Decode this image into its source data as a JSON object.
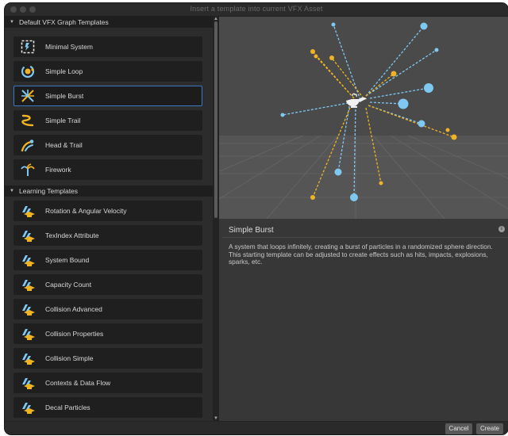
{
  "window": {
    "title": "Insert a template into current VFX Asset"
  },
  "sections": [
    {
      "label": "Default VFX Graph Templates",
      "items": [
        {
          "label": "Minimal System",
          "icon": "minimal-system-icon"
        },
        {
          "label": "Simple Loop",
          "icon": "simple-loop-icon"
        },
        {
          "label": "Simple Burst",
          "icon": "simple-burst-icon"
        },
        {
          "label": "Simple Trail",
          "icon": "simple-trail-icon"
        },
        {
          "label": "Head & Trail",
          "icon": "head-trail-icon"
        },
        {
          "label": "Firework",
          "icon": "firework-icon"
        }
      ]
    },
    {
      "label": "Learning Templates",
      "items": [
        {
          "label": "Rotation & Angular Velocity",
          "icon": "learning-icon"
        },
        {
          "label": "TexIndex Attribute",
          "icon": "learning-icon"
        },
        {
          "label": "System Bound",
          "icon": "learning-icon"
        },
        {
          "label": "Capacity Count",
          "icon": "learning-icon"
        },
        {
          "label": "Collision Advanced",
          "icon": "learning-icon"
        },
        {
          "label": "Collision Properties",
          "icon": "learning-icon"
        },
        {
          "label": "Collision Simple",
          "icon": "learning-icon"
        },
        {
          "label": "Contexts & Data Flow",
          "icon": "learning-icon"
        },
        {
          "label": "Decal Particles",
          "icon": "learning-icon"
        }
      ]
    }
  ],
  "selected": "Simple Burst",
  "detail": {
    "title": "Simple Burst",
    "description": "A system that loops infinitely, creating a burst of particles in a randomized sphere direction. This starting template can be adjusted to create effects such as hits, impacts, explosions, sparks, etc."
  },
  "footer": {
    "cancel_label": "Cancel",
    "create_label": "Create"
  },
  "colors": {
    "accent_blue": "#7ec8f2",
    "accent_orange": "#f0b323",
    "selection_border": "#3a78c4"
  }
}
